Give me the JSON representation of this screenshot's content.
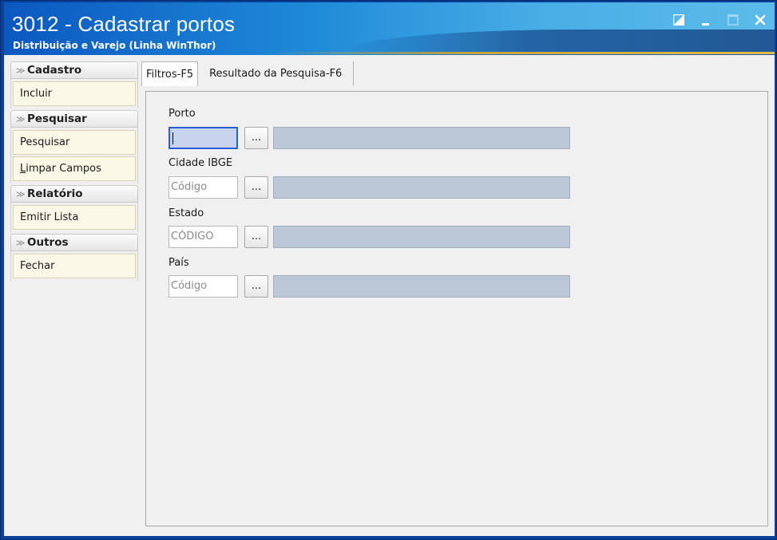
{
  "window": {
    "title": "3012 - Cadastrar portos",
    "subtitle": "Distribuição e Varejo (Linha WinThor)",
    "controls": [
      "restore-icon",
      "minimize-icon",
      "maximize-icon",
      "close-icon"
    ]
  },
  "sidebar": {
    "groups": [
      {
        "title": "Cadastro",
        "items": [
          {
            "label": "Incluir"
          }
        ]
      },
      {
        "title": "Pesquisar",
        "items": [
          {
            "label": "Pesquisar"
          },
          {
            "label": "Limpar Campos"
          }
        ]
      },
      {
        "title": "Relatório",
        "items": [
          {
            "label": "Emitir Lista"
          }
        ]
      },
      {
        "title": "Outros",
        "items": [
          {
            "label": "Fechar"
          }
        ]
      }
    ]
  },
  "tabs": [
    {
      "label": "Filtros-F5",
      "active": true
    },
    {
      "label": "Resultado da Pesquisa-F6",
      "active": false
    }
  ],
  "filters": {
    "porto": {
      "label": "Porto",
      "value": "",
      "button": "..."
    },
    "cidade": {
      "label": "Cidade IBGE",
      "placeholder": "Código",
      "button": "..."
    },
    "estado": {
      "label": "Estado",
      "placeholder": "CÓDIGO",
      "button": "..."
    },
    "pais": {
      "label": "País",
      "placeholder": "Código",
      "button": "..."
    }
  },
  "colors": {
    "title_gradient_start": "#0b58c0",
    "title_gradient_end": "#5cbbe9",
    "sidebar_item_bg": "#fbf8e8",
    "description_field_bg": "#bcc8d8",
    "focus_border": "#2b5fd1"
  }
}
